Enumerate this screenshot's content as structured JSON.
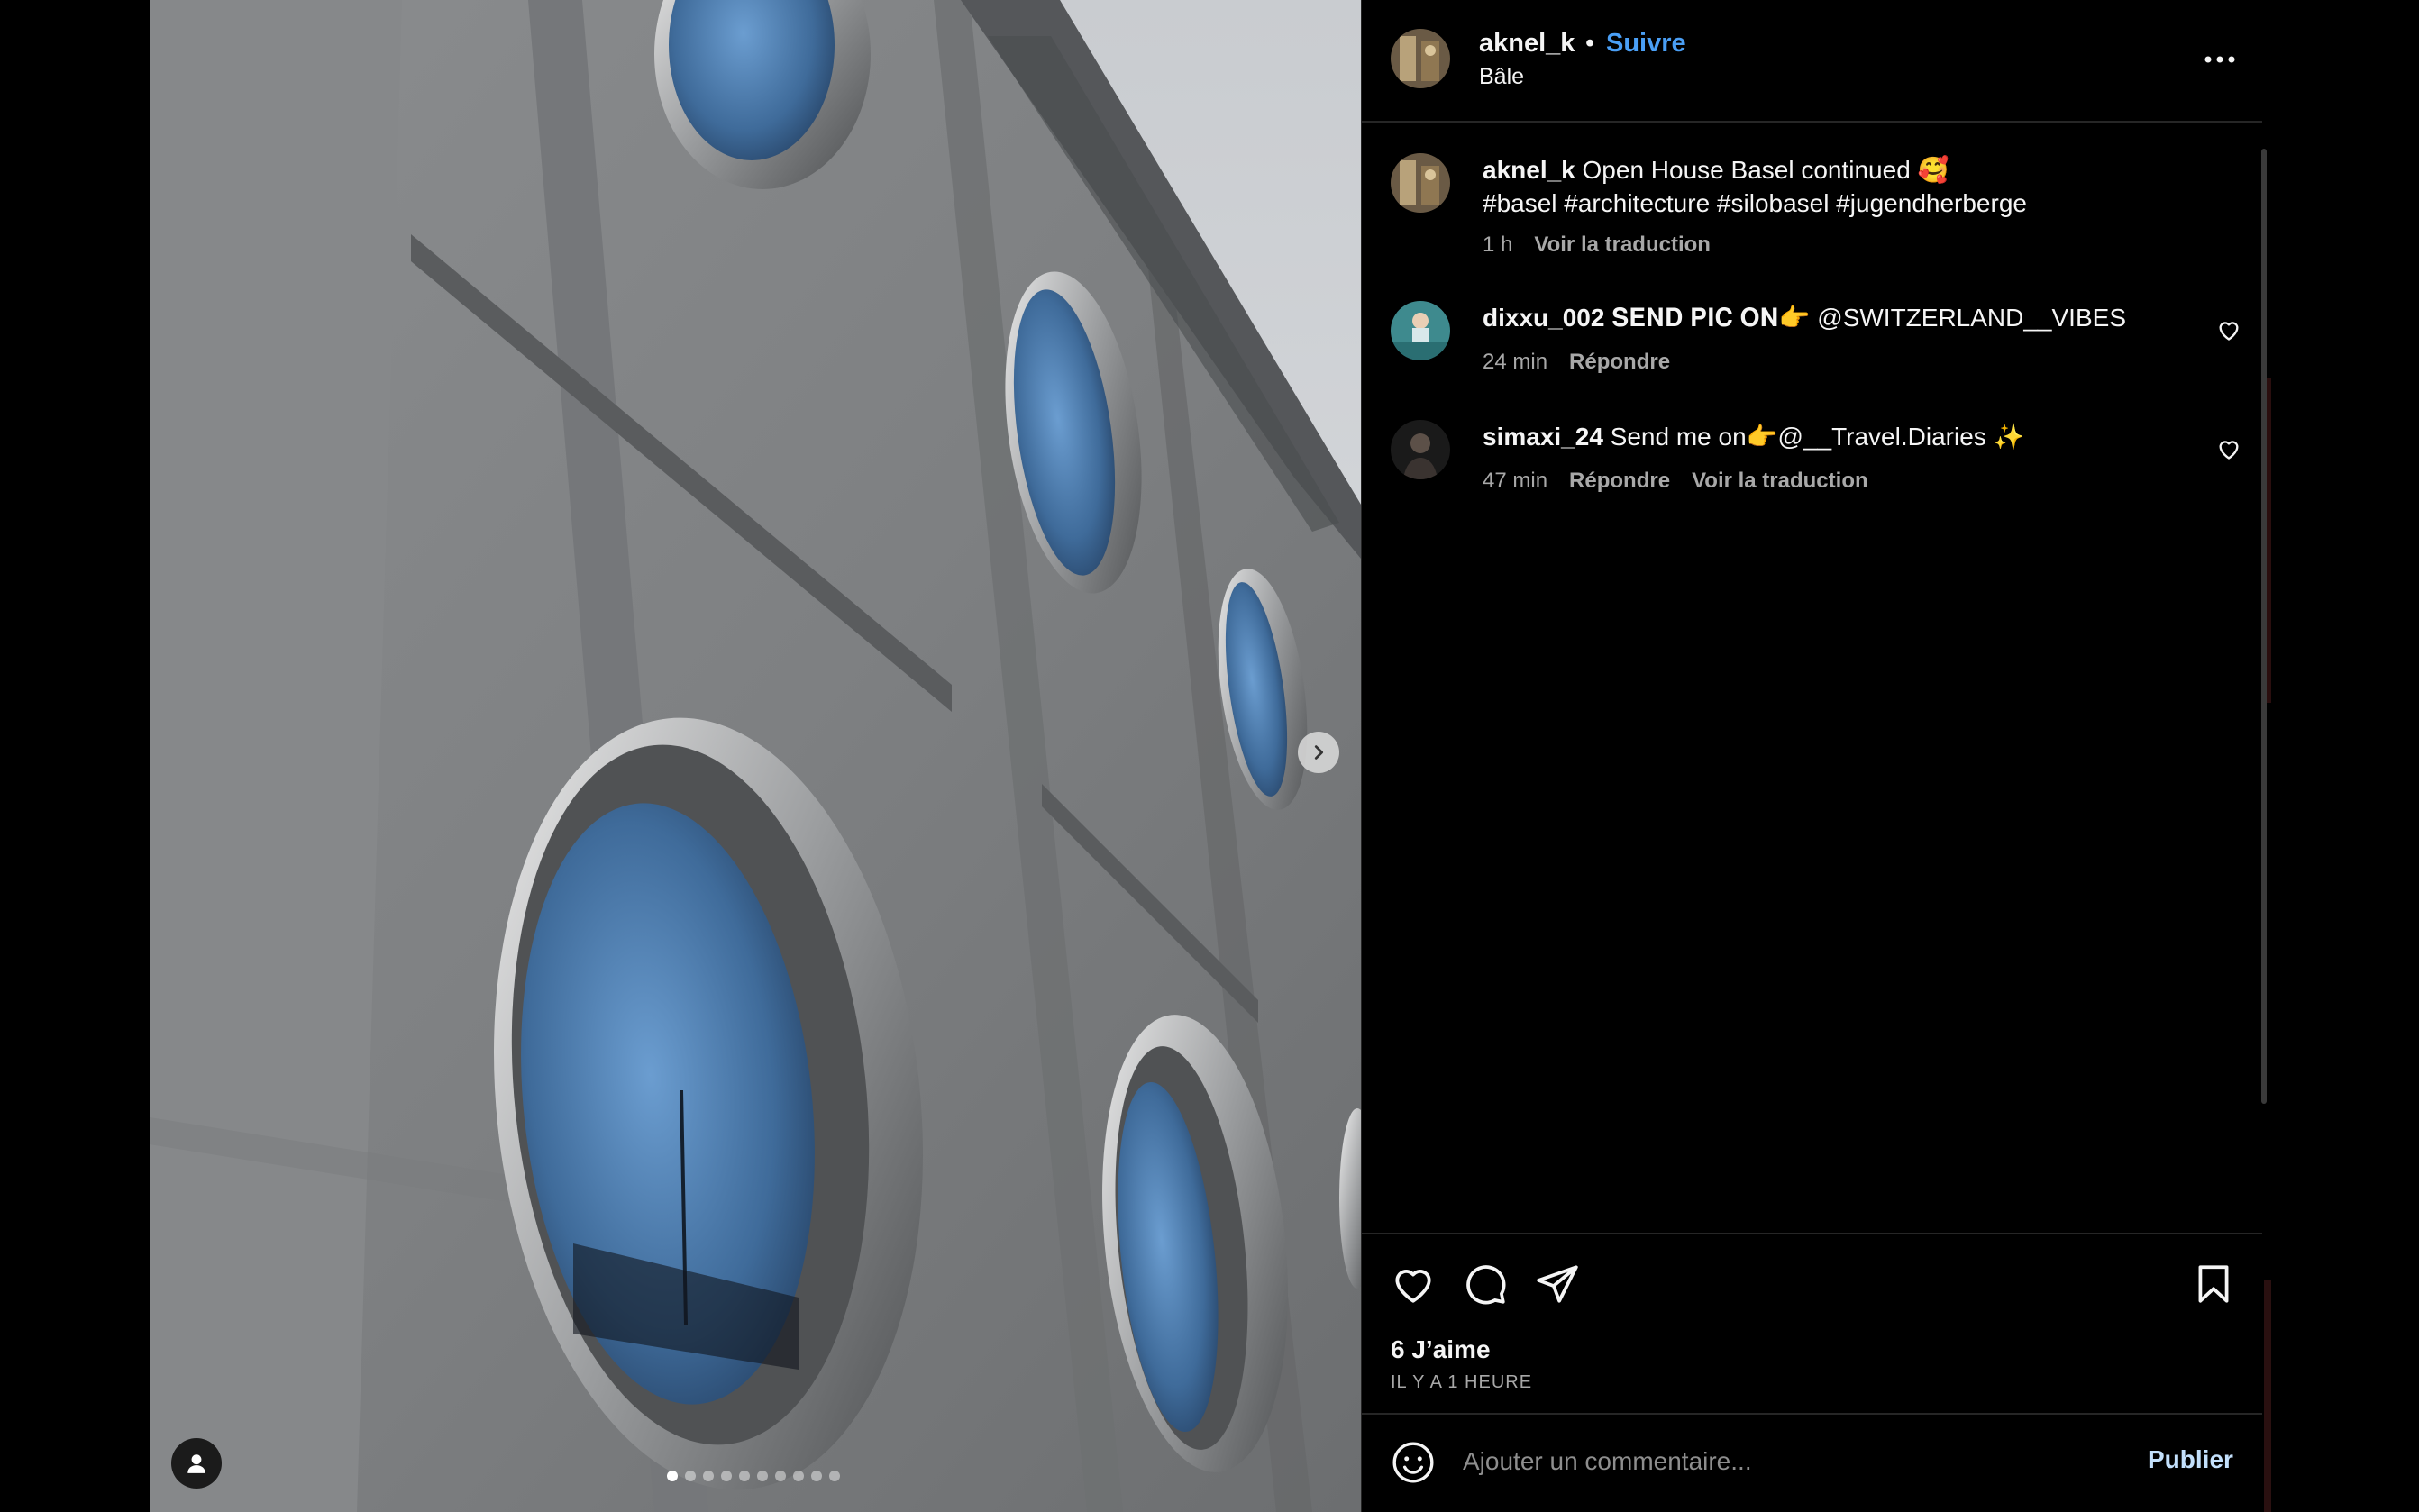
{
  "post": {
    "username": "aknel_k",
    "separator": "•",
    "follow_label": "Suivre",
    "location": "Bâle",
    "more_icon": "more-horizontal-icon"
  },
  "caption": {
    "username": "aknel_k",
    "text": "Open House Basel continued 🥰",
    "hashtags": "#basel #architecture #silobasel #jugendherberge",
    "time": "1 h",
    "translate_label": "Voir la traduction"
  },
  "comments": [
    {
      "username": "dixxu_002",
      "styled_text": "𝐒𝐄𝐍𝐃 𝐏𝐈𝐂 𝐎𝐍👉",
      "text": " @SWITZERLAND__VIBES",
      "time": "24 min",
      "reply_label": "Répondre"
    },
    {
      "username": "simaxi_24",
      "text": "Send me on👉@__Travel.Diaries ✨",
      "time": "47 min",
      "reply_label": "Répondre",
      "translate_label": "Voir la traduction"
    }
  ],
  "actions": {
    "like_icon": "heart-icon",
    "comment_icon": "comment-icon",
    "share_icon": "send-icon",
    "save_icon": "bookmark-icon",
    "likes_label": "6 J’aime",
    "time_ago": "IL Y A 1 HEURE"
  },
  "composer": {
    "placeholder": "Ajouter un commentaire...",
    "publish_label": "Publier",
    "emoji_icon": "emoji-icon"
  },
  "carousel": {
    "slide_count": 10,
    "active_index": 0,
    "next_icon": "chevron-right-icon",
    "tag_icon": "user-tag-icon"
  },
  "colors": {
    "accent": "#4a9ff5",
    "publish": "#c3e0fc",
    "background": "#000000",
    "secondary_text": "#a8a8a8"
  }
}
